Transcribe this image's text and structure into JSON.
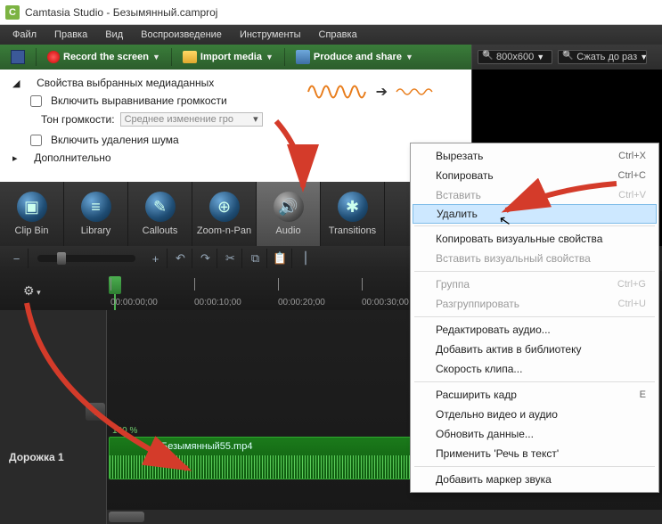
{
  "title": "Camtasia Studio - Безымянный.camproj",
  "menubar": [
    "Файл",
    "Правка",
    "Вид",
    "Воспроизведение",
    "Инструменты",
    "Справка"
  ],
  "toolbar": {
    "record": "Record the screen",
    "import": "Import media",
    "produce": "Produce and share"
  },
  "toolbar_right": {
    "dimensions": "800x600",
    "shrink": "Сжать до раз"
  },
  "props": {
    "heading": "Свойства выбранных медиаданных",
    "volume_leveling": "Включить выравнивание громкости",
    "tone_label": "Тон громкости:",
    "tone_combo": "Среднее изменение гро",
    "noise_removal": "Включить удаления шума",
    "advanced": "Дополнительно"
  },
  "tooltabs": {
    "clipbin": "Clip Bin",
    "library": "Library",
    "callouts": "Callouts",
    "zoom": "Zoom-n-Pan",
    "audio": "Audio",
    "transitions": "Transitions"
  },
  "timeline": {
    "labels": [
      "00:00:00;00",
      "00:00:10;00",
      "00:00:20;00",
      "00:00:30;00"
    ],
    "track1": "Дорожка 1",
    "clip_name": "Безымянный55.mp4",
    "percent": "100 %"
  },
  "context_menu": {
    "cut": {
      "label": "Вырезать",
      "sc": "Ctrl+X"
    },
    "copy": {
      "label": "Копировать",
      "sc": "Ctrl+C"
    },
    "paste": {
      "label": "Вставить",
      "sc": "Ctrl+V"
    },
    "delete": {
      "label": "Удалить"
    },
    "copy_visual": {
      "label": "Копировать визуальные свойства"
    },
    "paste_visual": {
      "label": "Вставить визуальный свойства"
    },
    "group": {
      "label": "Группа",
      "sc": "Ctrl+G"
    },
    "ungroup": {
      "label": "Разгруппировать",
      "sc": "Ctrl+U"
    },
    "edit_audio": {
      "label": "Редактировать аудио..."
    },
    "add_asset": {
      "label": "Добавить актив в библиотеку"
    },
    "clip_speed": {
      "label": "Скорость клипа..."
    },
    "extend_frame": {
      "label": "Расширить кадр",
      "sc": "E"
    },
    "separate_av": {
      "label": "Отдельно видео и аудио"
    },
    "update_data": {
      "label": "Обновить данные..."
    },
    "speech_to_text": {
      "label": "Применить 'Речь в текст'"
    },
    "add_marker": {
      "label": "Добавить маркер звука"
    }
  }
}
